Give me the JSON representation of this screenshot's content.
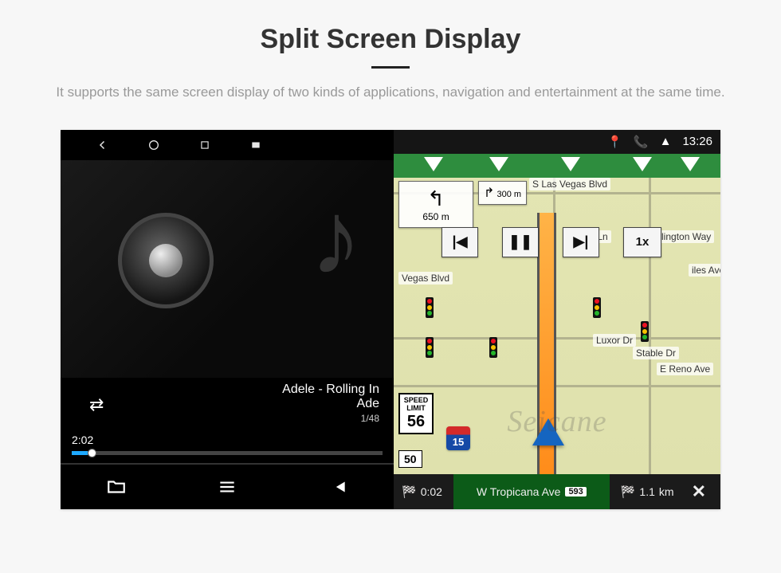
{
  "header": {
    "title": "Split Screen Display",
    "subtitle": "It supports the same screen display of two kinds of applications, navigation and entertainment at the same time."
  },
  "music": {
    "track_title": "Adele - Rolling In",
    "artist": "Ade",
    "index": "1/48",
    "elapsed": "2:02"
  },
  "status_bar": {
    "time": "13:26"
  },
  "nav": {
    "turn_distance_main": "650",
    "turn_unit_main": "m",
    "next_turn_distance": "300",
    "next_turn_unit": "m",
    "speed_button": "1x",
    "streets": {
      "s_las_vegas": "S Las Vegas Blvd",
      "koval": "Koval Ln",
      "duke": "Duke Ellington Way",
      "vegas_blvd": "Vegas Blvd",
      "luxor": "Luxor Dr",
      "stable": "Stable Dr",
      "reno": "E Reno Ave",
      "iles": "iles Ave"
    },
    "speed_limit_label": "SPEED LIMIT",
    "speed_limit_value": "56",
    "route_label": "50",
    "interstate": "15",
    "bottom": {
      "eta": "0:02",
      "remaining_dist": "1.1",
      "remaining_unit": "km",
      "current_road": "W Tropicana Ave",
      "road_pill": "593"
    }
  },
  "watermark": "Seicane"
}
